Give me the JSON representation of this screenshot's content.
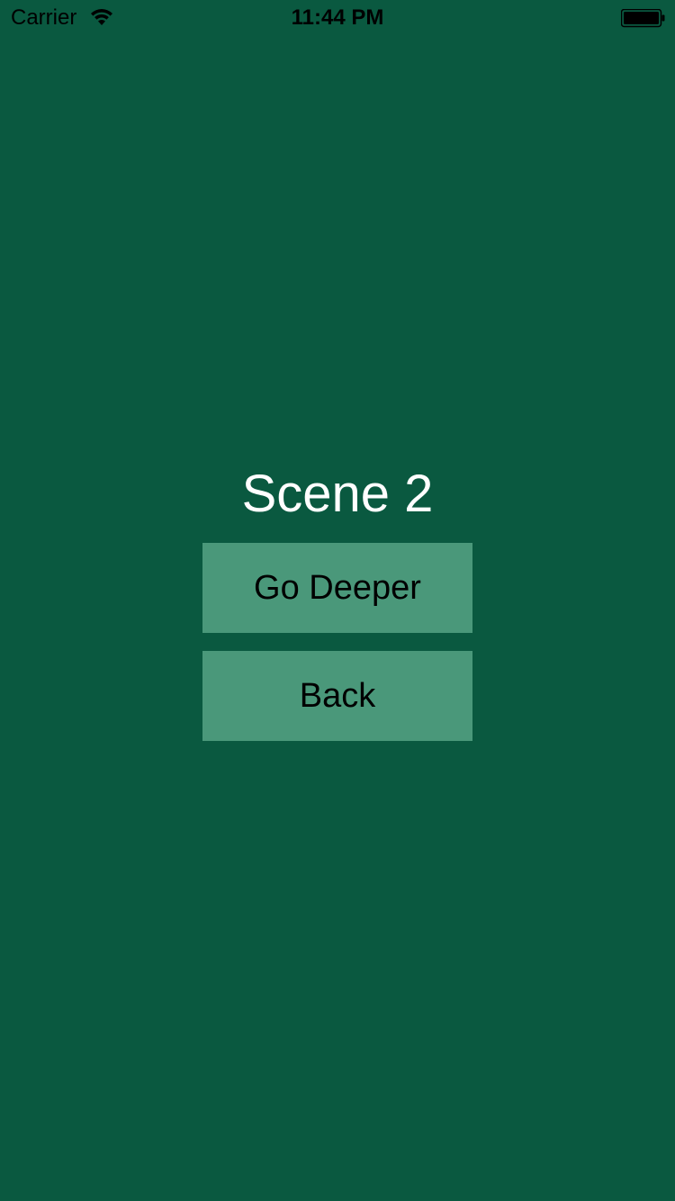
{
  "status_bar": {
    "carrier": "Carrier",
    "time": "11:44 PM",
    "wifi_icon": "wifi-icon",
    "battery_icon": "battery-icon"
  },
  "scene": {
    "title": "Scene 2",
    "background_color": "#0a5940",
    "button_color": "#4a987a"
  },
  "buttons": {
    "go_deeper": "Go Deeper",
    "back": "Back"
  }
}
